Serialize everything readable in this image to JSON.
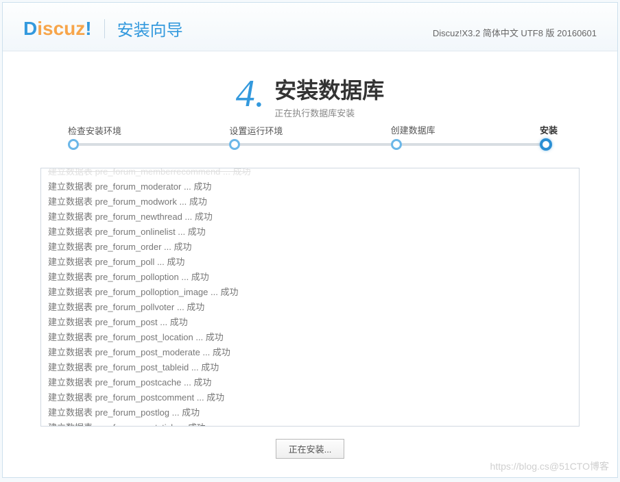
{
  "header": {
    "logo_d": "D",
    "logo_rest": "iscuz",
    "logo_ex": "!",
    "wizard_title": "安装向导",
    "version": "Discuz!X3.2 简体中文 UTF8 版 20160601"
  },
  "step": {
    "number": "4.",
    "title": "安装数据库",
    "subtitle": "正在执行数据库安装"
  },
  "progress": {
    "steps": [
      {
        "label": "检查安装环境",
        "done": true
      },
      {
        "label": "设置运行环境",
        "done": true
      },
      {
        "label": "创建数据库",
        "done": true
      },
      {
        "label": "安装",
        "active": true
      }
    ]
  },
  "log": {
    "lines": [
      "建立数据表 pre_forum_memberrecommend ... 成功",
      "建立数据表 pre_forum_moderator ... 成功",
      "建立数据表 pre_forum_modwork ... 成功",
      "建立数据表 pre_forum_newthread ... 成功",
      "建立数据表 pre_forum_onlinelist ... 成功",
      "建立数据表 pre_forum_order ... 成功",
      "建立数据表 pre_forum_poll ... 成功",
      "建立数据表 pre_forum_polloption ... 成功",
      "建立数据表 pre_forum_polloption_image ... 成功",
      "建立数据表 pre_forum_pollvoter ... 成功",
      "建立数据表 pre_forum_post ... 成功",
      "建立数据表 pre_forum_post_location ... 成功",
      "建立数据表 pre_forum_post_moderate ... 成功",
      "建立数据表 pre_forum_post_tableid ... 成功",
      "建立数据表 pre_forum_postcache ... 成功",
      "建立数据表 pre_forum_postcomment ... 成功",
      "建立数据表 pre_forum_postlog ... 成功",
      "建立数据表 pre_forum_poststick ... 成功"
    ]
  },
  "button": {
    "installing": "正在安装..."
  },
  "watermark": "https://blog.cs@51CTO博客"
}
